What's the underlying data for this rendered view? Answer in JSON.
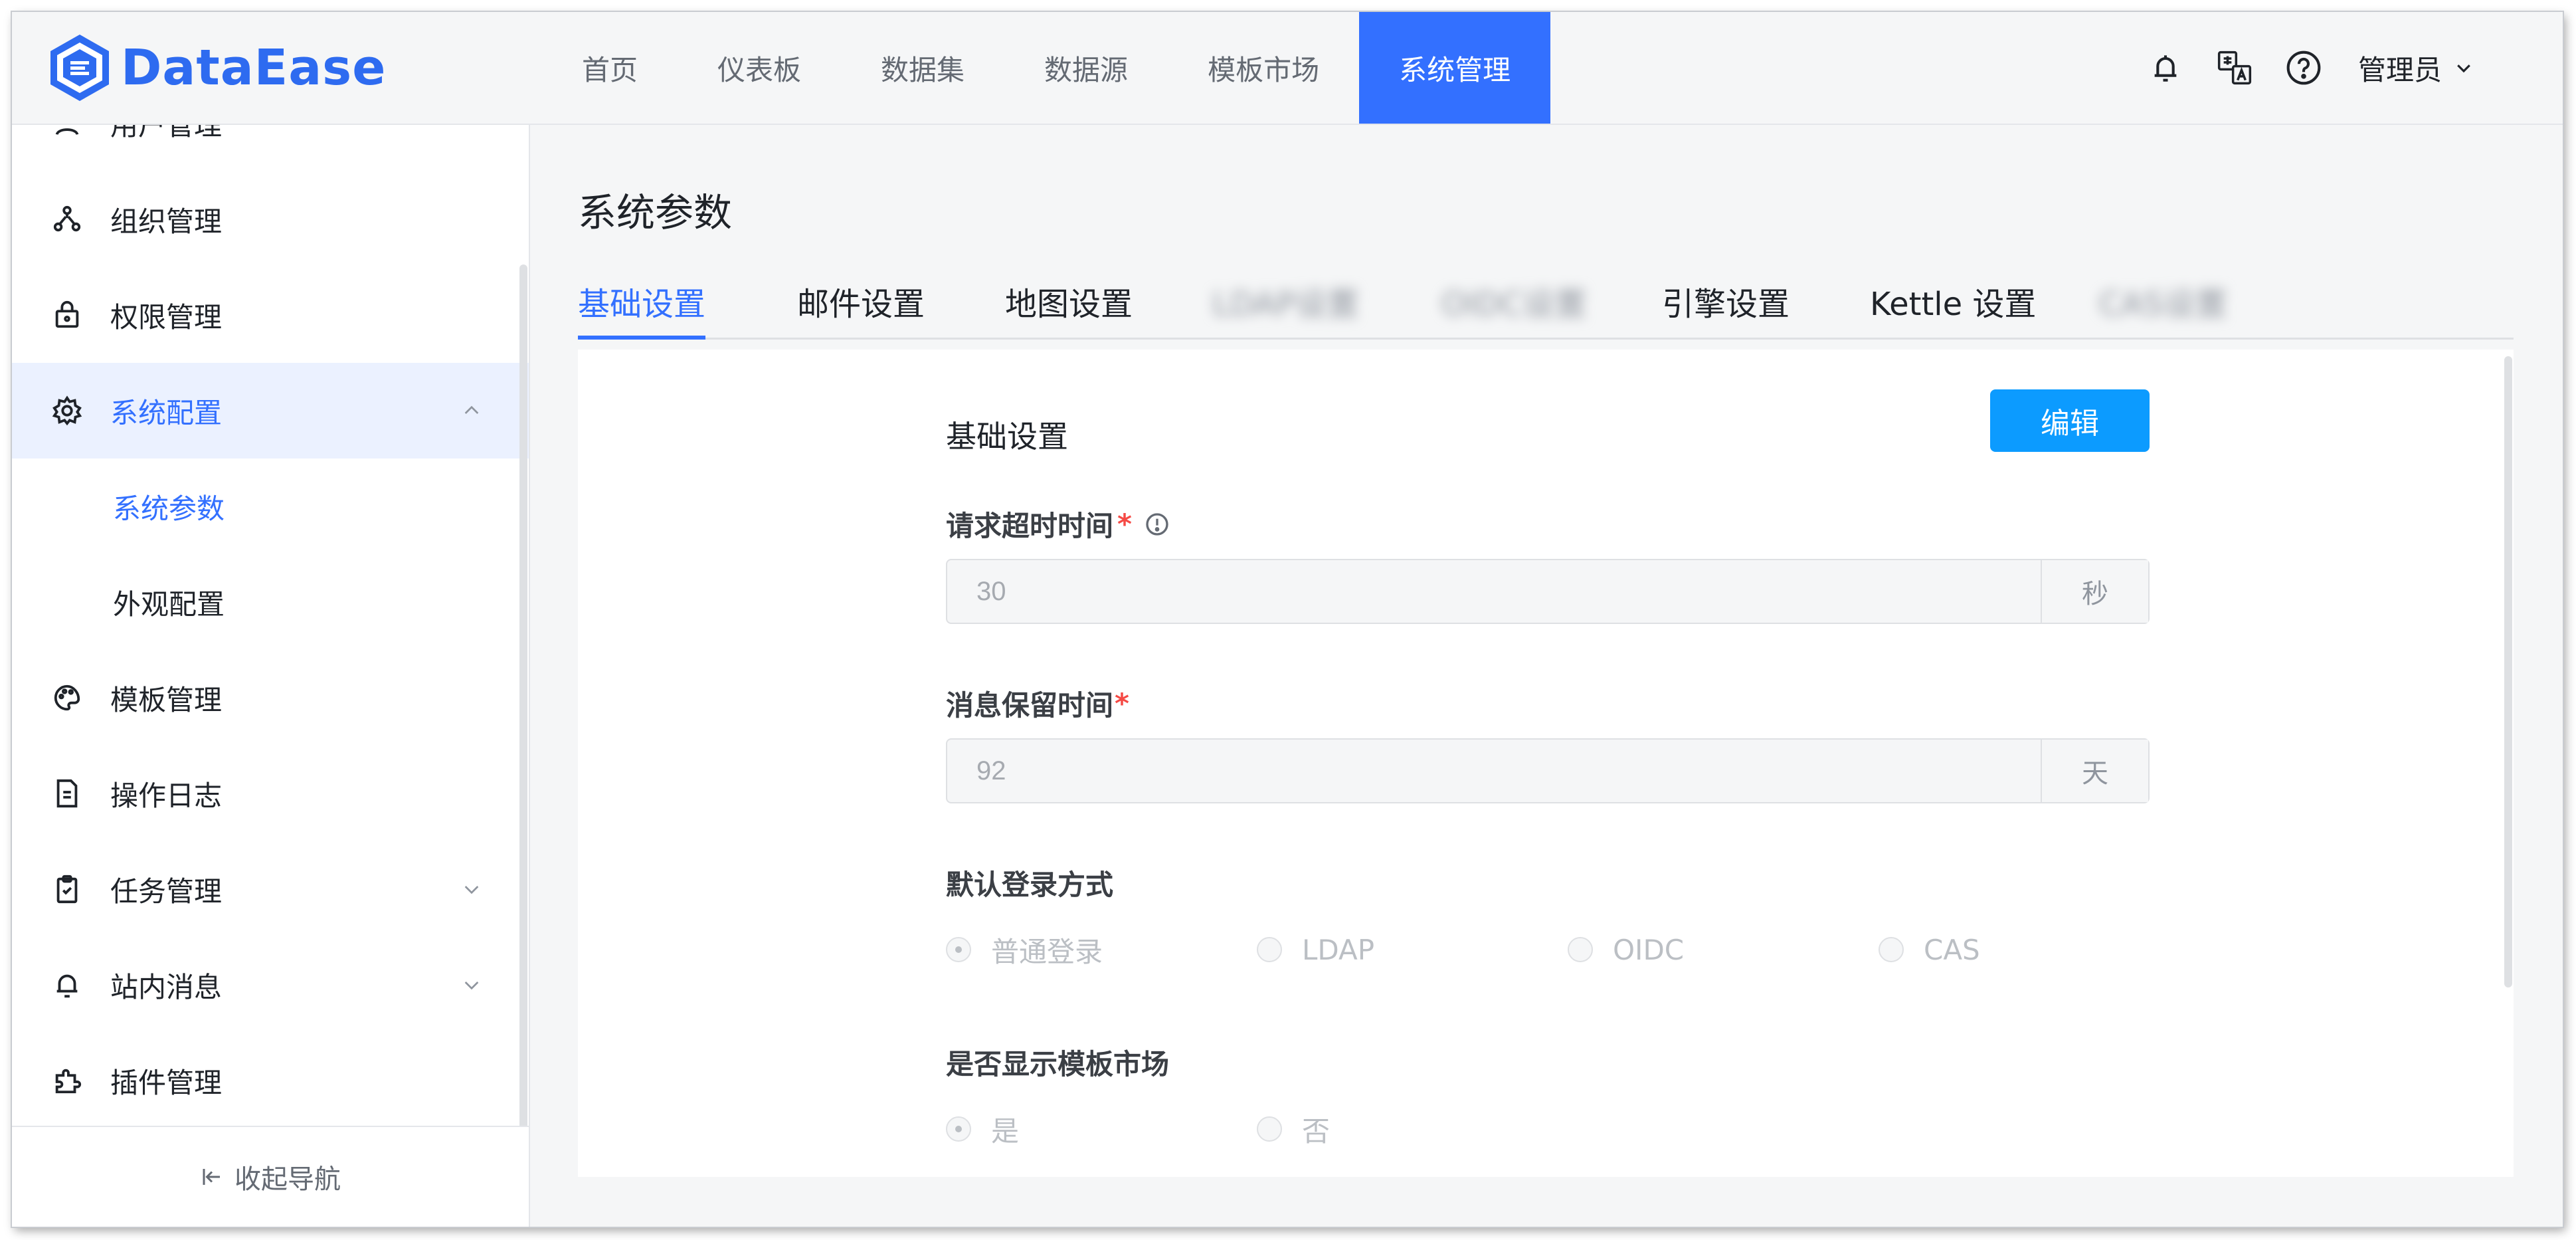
{
  "app": {
    "logo_text": "DataEase"
  },
  "topnav": {
    "items": [
      "首页",
      "仪表板",
      "数据集",
      "数据源",
      "模板市场",
      "系统管理"
    ],
    "active": "系统管理"
  },
  "header": {
    "user_name": "管理员"
  },
  "sidebar": {
    "items": [
      {
        "label": "用户管理",
        "icon": "user-icon"
      },
      {
        "label": "组织管理",
        "icon": "org-icon"
      },
      {
        "label": "权限管理",
        "icon": "lock-icon"
      },
      {
        "label": "系统配置",
        "icon": "gear-icon"
      },
      {
        "label": "系统参数"
      },
      {
        "label": "外观配置"
      },
      {
        "label": "模板管理",
        "icon": "palette-icon"
      },
      {
        "label": "操作日志",
        "icon": "document-icon"
      },
      {
        "label": "任务管理",
        "icon": "clipboard-icon"
      },
      {
        "label": "站内消息",
        "icon": "bell-icon"
      },
      {
        "label": "插件管理",
        "icon": "plugin-icon"
      }
    ],
    "collapse_label": "收起导航"
  },
  "main": {
    "title": "系统参数",
    "tabs": [
      "基础设置",
      "邮件设置",
      "地图设置",
      "LDAP设置",
      "OIDC设置",
      "引擎设置",
      "Kettle 设置",
      "CAS设置"
    ],
    "active_tab": "基础设置",
    "section_title": "基础设置",
    "edit_label": "编辑",
    "fields": {
      "timeout": {
        "label": "请求超时时间",
        "required_mark": "*",
        "value": "30",
        "suffix": "秒"
      },
      "retention": {
        "label": "消息保留时间",
        "required_mark": "*",
        "value": "92",
        "suffix": "天"
      },
      "login": {
        "label": "默认登录方式",
        "options": [
          "普通登录",
          "LDAP",
          "OIDC",
          "CAS"
        ],
        "selected": "普通登录"
      },
      "market": {
        "label": "是否显示模板市场",
        "options": [
          "是",
          "否"
        ],
        "selected": "是"
      }
    }
  },
  "colors": {
    "accent": "#3370ff",
    "edit_button": "#0c9bff",
    "required": "#f54a45"
  }
}
